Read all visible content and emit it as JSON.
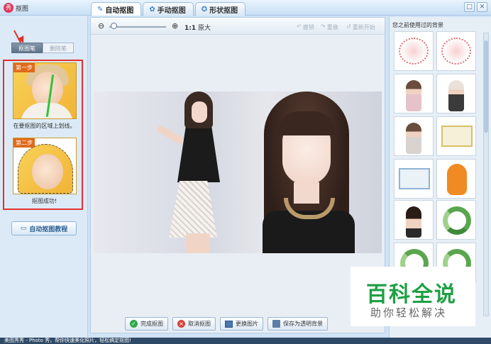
{
  "window": {
    "title": "抠图",
    "close": "✕",
    "restore": "□"
  },
  "tabs": [
    {
      "label": "自动抠图",
      "active": true
    },
    {
      "label": "手动抠图",
      "active": false
    },
    {
      "label": "形状抠图",
      "active": false
    }
  ],
  "left": {
    "mode_active": "抠图笔",
    "mode_inactive": "删除笔",
    "step1_tag": "第一步",
    "step1_caption": "在要抠图的区域上划线。",
    "step2_tag": "第二步",
    "step2_caption": "抠图成功!",
    "tutorial_label": "自动抠图教程"
  },
  "toolbar": {
    "ratio": "1:1",
    "ratio_label": "原大",
    "undo": "撤销",
    "redo": "重做",
    "restart": "重新开始"
  },
  "actions": {
    "done": "完成抠图",
    "cancel": "取消抠图",
    "replace": "更换图片",
    "save": "保存为透明背景"
  },
  "right": {
    "title": "您之前使用过的背景"
  },
  "watermark": {
    "main": "百科全说",
    "sub": "助你轻松解决"
  },
  "status": "美图秀秀 - Photo 秀，帮你快速美化照片，轻松搞定抠图!",
  "colors": {
    "accent": "#2d5f92",
    "highlight": "#e0312c",
    "brand_green": "#1fa044"
  }
}
